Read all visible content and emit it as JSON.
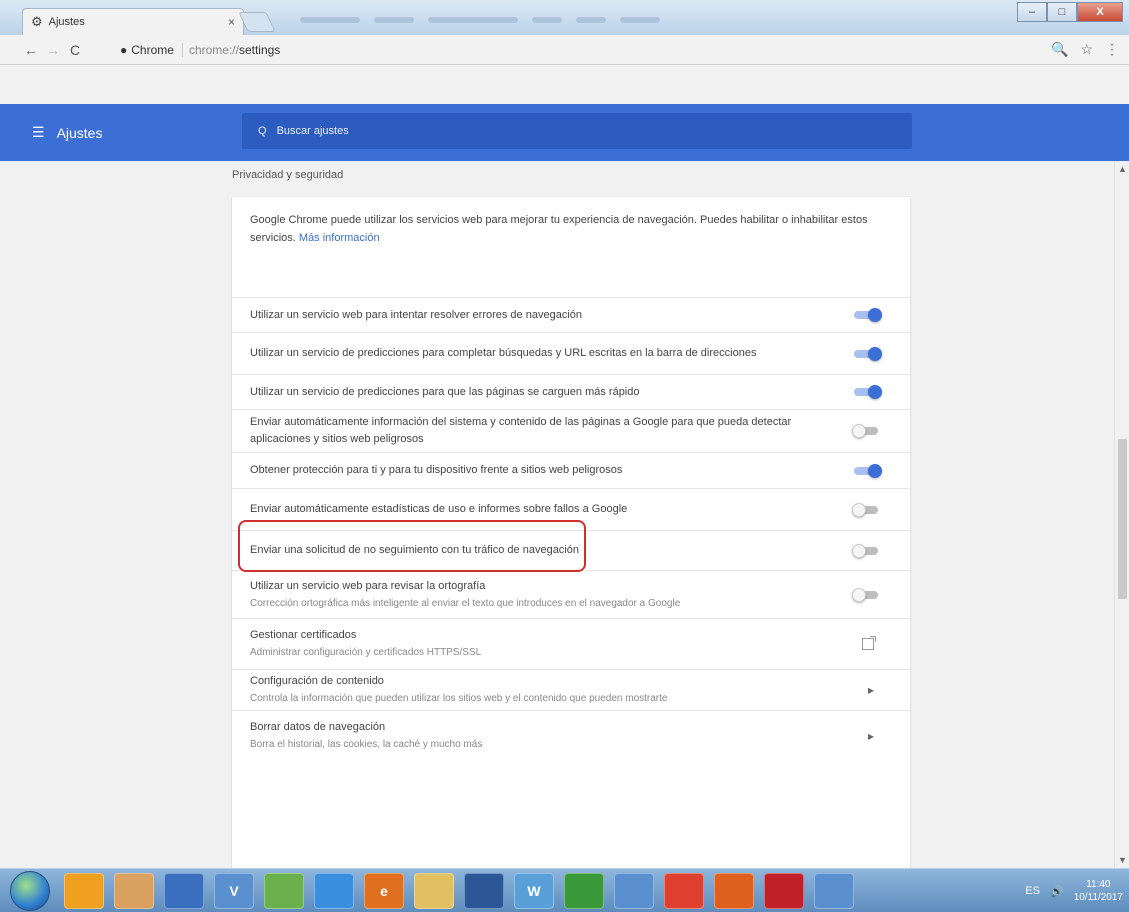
{
  "tab": {
    "title": "Ajustes",
    "close_glyph": "×"
  },
  "toolbar": {
    "back_glyph": "←",
    "forward_glyph": "→",
    "reload_glyph": "C",
    "secure_label": "Chrome",
    "url_scheme": "chrome://",
    "url_path": "settings",
    "zoom_glyph": "🔍",
    "star_glyph": "☆",
    "menu_glyph": "⋮"
  },
  "window_controls": {
    "minimize": "–",
    "maximize": "□",
    "close": "X"
  },
  "header": {
    "menu_glyph": "☰",
    "title": "Ajustes",
    "search_placeholder": "Buscar ajustes",
    "search_glyph": "Q"
  },
  "section": {
    "title": "Privacidad y seguridad"
  },
  "intro": {
    "text": "Google Chrome puede utilizar los servicios web para mejorar tu experiencia de navegación. Puedes habilitar o inhabilitar estos servicios. ",
    "link": "Más información"
  },
  "settings": [
    {
      "label": "Utilizar un servicio web para intentar resolver errores de navegación",
      "sub": "",
      "control": "toggle",
      "state": "on"
    },
    {
      "label": "Utilizar un servicio de predicciones para completar búsquedas y URL escritas en la barra de direcciones",
      "sub": "",
      "control": "toggle",
      "state": "on"
    },
    {
      "label": "Utilizar un servicio de predicciones para que las páginas se carguen más rápido",
      "sub": "",
      "control": "toggle",
      "state": "on"
    },
    {
      "label": "Enviar automáticamente información del sistema y contenido de las páginas a Google para que pueda detectar aplicaciones y sitios web peligrosos",
      "sub": "",
      "control": "toggle",
      "state": "off"
    },
    {
      "label": "Obtener protección para ti y para tu dispositivo frente a sitios web peligrosos",
      "sub": "",
      "control": "toggle",
      "state": "on"
    },
    {
      "label": "Enviar automáticamente estadísticas de uso e informes sobre fallos a Google",
      "sub": "",
      "control": "toggle",
      "state": "off"
    },
    {
      "label": "Enviar una solicitud de no seguimiento con tu tráfico de navegación",
      "sub": "",
      "control": "toggle",
      "state": "off"
    },
    {
      "label": "Utilizar un servicio web para revisar la ortografía",
      "sub": "Corrección ortográfica más inteligente al enviar el texto que introduces en el navegador a Google",
      "control": "toggle",
      "state": "off"
    },
    {
      "label": "Gestionar certificados",
      "sub": "Administrar configuración y certificados HTTPS/SSL",
      "control": "external",
      "state": ""
    },
    {
      "label": "Configuración de contenido",
      "sub": "Controla la información que pueden utilizar los sitios web y el contenido que pueden mostrarte",
      "control": "arrow",
      "state": ""
    },
    {
      "label": "Borrar datos de navegación",
      "sub": "Borra el historial, las cookies, la caché y mucho más",
      "control": "arrow",
      "state": ""
    }
  ],
  "taskbar": {
    "apps": [
      "",
      "",
      "",
      "V",
      "",
      "",
      "e",
      "",
      "",
      "W",
      "",
      "",
      "",
      "",
      "",
      ""
    ],
    "tray": {
      "lang": "ES",
      "time": "11:40",
      "date": "10/11/2017"
    }
  }
}
